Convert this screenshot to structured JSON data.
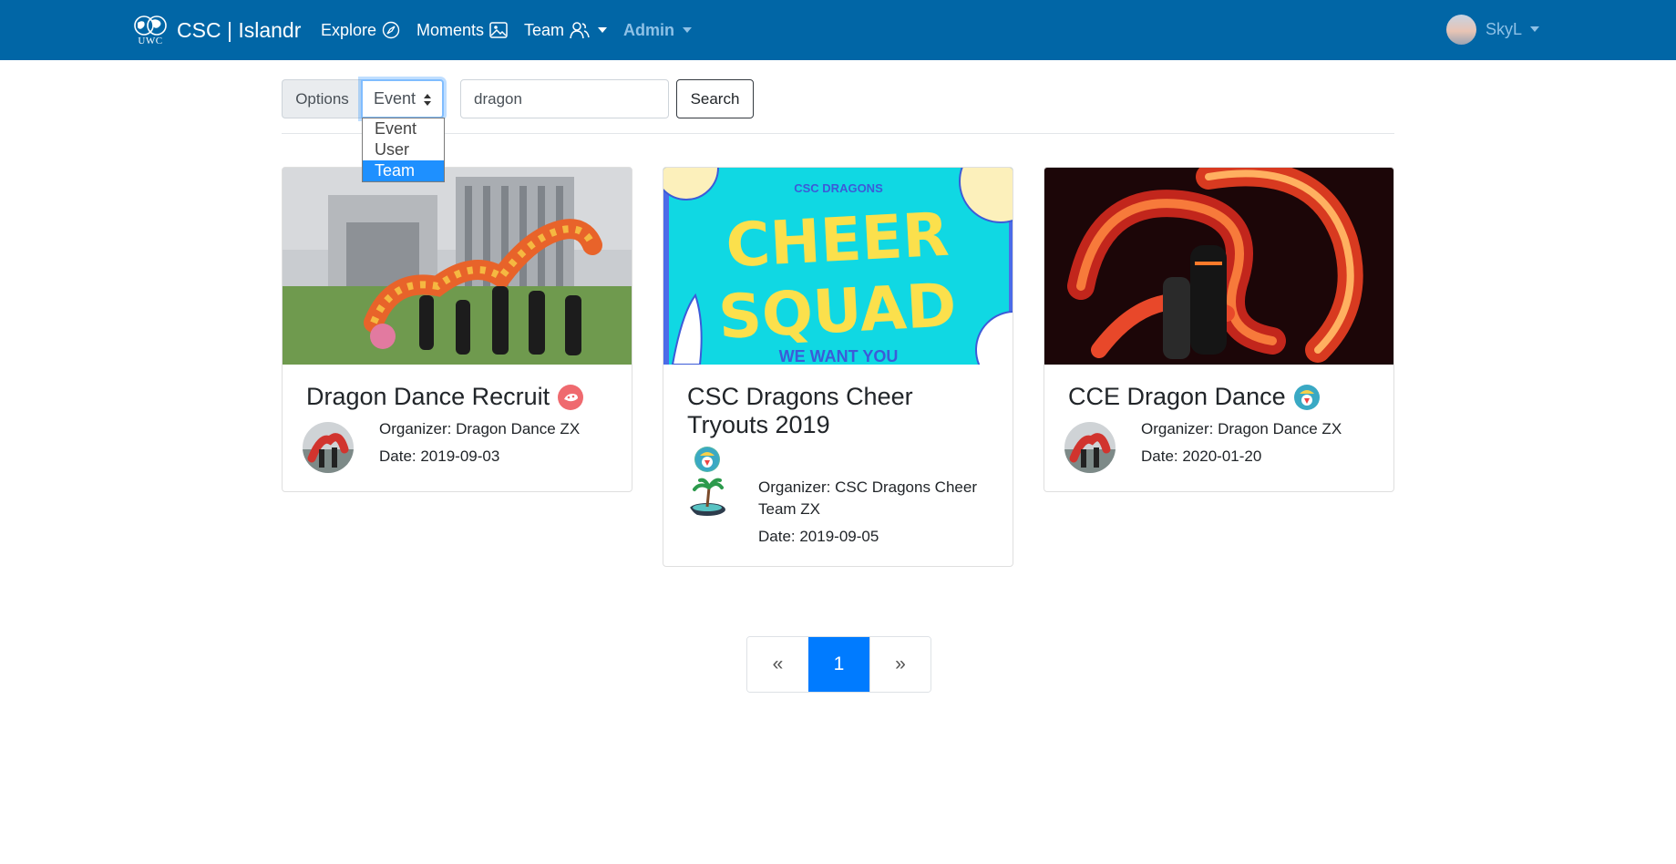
{
  "navbar": {
    "logo_text": "UWC",
    "brand": "CSC | Islandr",
    "explore": "Explore",
    "moments": "Moments",
    "team": "Team",
    "admin": "Admin",
    "user": "SkyL"
  },
  "search": {
    "options_label": "Options",
    "selected": "Event",
    "dropdown_options": [
      "Event",
      "User",
      "Team"
    ],
    "highlighted_option": "Team",
    "query": "dragon",
    "button": "Search"
  },
  "cards": [
    {
      "title": "Dragon Dance Recruit",
      "organizer": "Organizer: Dragon Dance ZX",
      "date": "Date: 2019-09-03"
    },
    {
      "title": "CSC Dragons Cheer Tryouts 2019",
      "image_text_top": "CSC DRAGONS",
      "image_text_line1": "CHEER",
      "image_text_line2": "SQUAD",
      "image_text_bottom": "WE WANT YOU",
      "organizer": "Organizer: CSC Dragons Cheer Team ZX",
      "date": "Date: 2019-09-05"
    },
    {
      "title": "CCE Dragon Dance",
      "organizer": "Organizer: Dragon Dance ZX",
      "date": "Date: 2020-01-20"
    }
  ],
  "pagination": {
    "prev": "«",
    "current": "1",
    "next": "»"
  },
  "colors": {
    "navbar": "#0166a6",
    "primary": "#007bff"
  }
}
